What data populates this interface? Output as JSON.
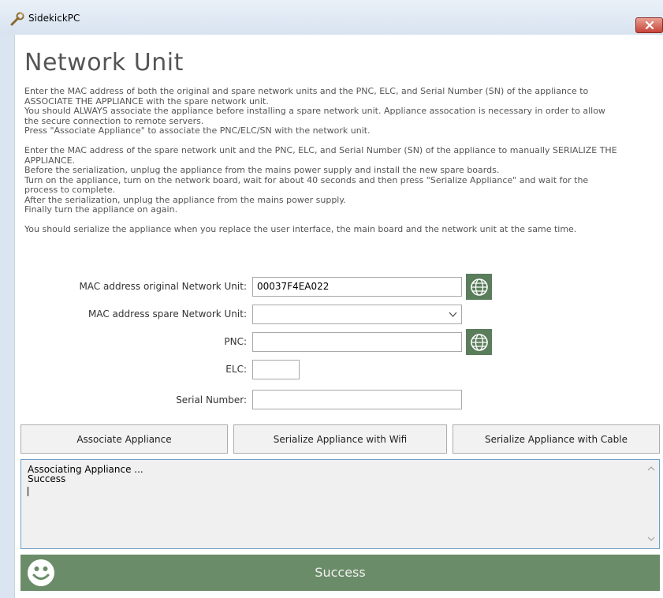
{
  "window": {
    "title": "SidekickPC",
    "app_icon": "wrench-icon",
    "close_icon": "close-icon"
  },
  "page": {
    "title": "Network Unit",
    "instructions": [
      "Enter the MAC address of both the original and spare network units and the PNC, ELC, and Serial Number (SN) of the appliance to",
      "ASSOCIATE THE APPLIANCE with the spare network unit.",
      "You should ALWAYS associate the appliance before installing a spare network unit.  Appliance assocation is necessary in order to allow",
      "the secure connection to remote servers.",
      "Press \"Associate Appliance\" to associate the PNC/ELC/SN with the network unit.",
      "",
      "Enter the MAC address of the spare network unit and the PNC, ELC, and Serial Number (SN) of the appliance to manually SERIALIZE THE",
      "APPLIANCE.",
      "Before the serialization, unplug the appliance from the mains power supply and install the new spare boards.",
      "Turn on the appliance, turn on the network board, wait for about 40 seconds and then press \"Serialize Appliance\" and wait for the",
      "process to complete.",
      "After the serialization, unplug the appliance from the mains power supply.",
      "Finally turn the appliance on again.",
      "",
      "You should serialize the appliance when you replace the user interface, the main board and the network unit at the same time."
    ]
  },
  "form": {
    "mac_original": {
      "label": "MAC address original Network Unit:",
      "value": "00037F4EA022"
    },
    "mac_spare": {
      "label": "MAC address spare Network Unit:",
      "value": ""
    },
    "pnc": {
      "label": "PNC:",
      "value": ""
    },
    "elc": {
      "label": "ELC:",
      "value": ""
    },
    "serial": {
      "label": "Serial Number:",
      "value": ""
    },
    "globe_icon": "globe-icon"
  },
  "actions": {
    "associate": "Associate Appliance",
    "serialize_wifi": "Serialize Appliance with Wifi",
    "serialize_cable": "Serialize Appliance with Cable"
  },
  "log": {
    "lines": "Associating Appliance ...\nSuccess"
  },
  "status": {
    "text": "Success",
    "icon": "smiley-icon",
    "color": "#6b8c68"
  }
}
